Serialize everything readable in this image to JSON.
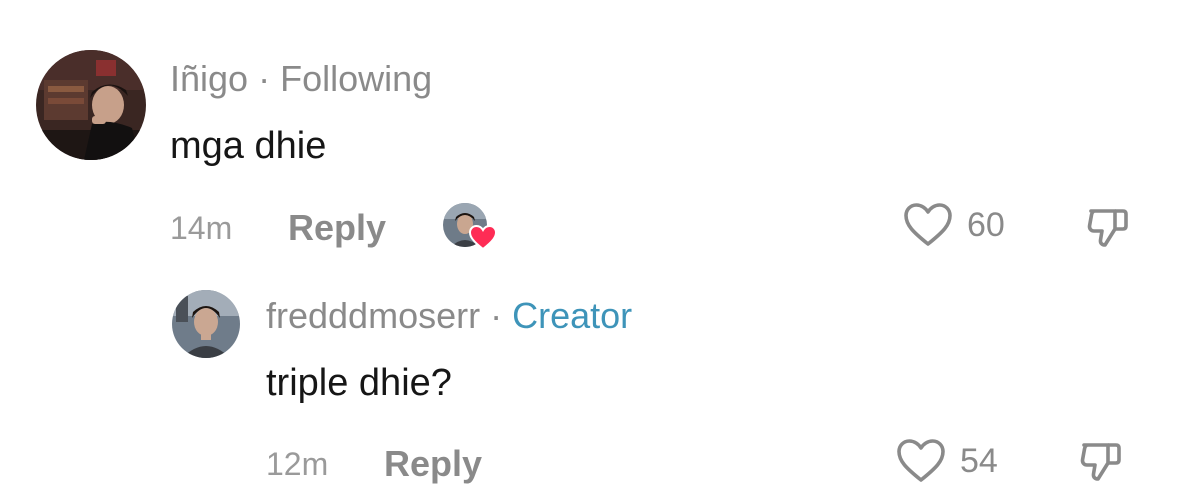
{
  "comments": [
    {
      "username": "Iñigo",
      "relation": "Following",
      "text": "mga dhie",
      "time": "14m",
      "reply_label": "Reply",
      "likes": "60",
      "liked_by_creator": true
    },
    {
      "username": "fredddmoserr",
      "relation": "Creator",
      "text": "triple dhie?",
      "time": "12m",
      "reply_label": "Reply",
      "likes": "54",
      "liked_by_creator": false
    }
  ],
  "icons": {
    "like": "heart-outline-icon",
    "dislike": "thumbs-down-icon",
    "creator_liked": "heart-filled-icon"
  },
  "colors": {
    "meta_gray": "#8a8a8a",
    "creator_blue": "#3e94b9",
    "heart_red": "#fe2c55"
  }
}
